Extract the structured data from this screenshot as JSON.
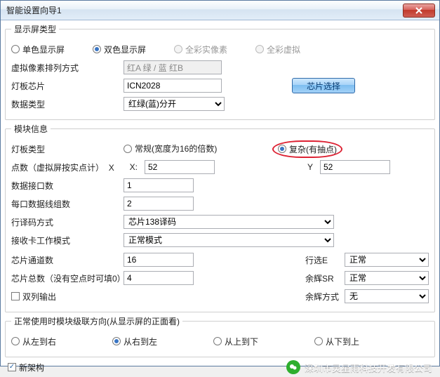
{
  "window": {
    "title": "智能设置向导1"
  },
  "group_display": {
    "legend": "显示屏类型",
    "opts": {
      "mono": "单色显示屏",
      "dual": "双色显示屏",
      "real": "全彩实像素",
      "virt": "全彩虚拟"
    },
    "virtual_arrange_label": "虚拟像素排列方式",
    "virtual_arrange_value": "红A 绿 / 蓝 红B",
    "chip_label": "灯板芯片",
    "chip_value": "ICN2028",
    "chip_btn": "芯片选择",
    "data_type_label": "数据类型",
    "data_type_value": "红绿(蓝)分开"
  },
  "group_module": {
    "legend": "模块信息",
    "board_type_label": "灯板类型",
    "board_type_normal": "常规(宽度为16的倍数)",
    "board_type_complex": "复杂(有抽点)",
    "points_label": "点数（虚拟屏按实点计）",
    "x_label": "X",
    "x_val": "52",
    "y_label": "Y",
    "y_val": "52",
    "port_label": "数据接口数",
    "port_val": "1",
    "lines_label": "每口数据线组数",
    "lines_val": "2",
    "decode_label": "行译码方式",
    "decode_val": "芯片138译码",
    "recv_mode_label": "接收卡工作模式",
    "recv_mode_val": "正常模式",
    "channels_label": "芯片通道数",
    "channels_val": "16",
    "total_label": "芯片总数（没有空点时可填0）",
    "total_val": "4",
    "dual_out": "双列输出",
    "row_e_label": "行选E",
    "row_e_val": "正常",
    "afterglow_sr_label": "余辉SR",
    "afterglow_sr_val": "正常",
    "afterglow_mode_label": "余辉方式",
    "afterglow_mode_val": "无"
  },
  "group_dir": {
    "legend": "正常使用时模块级联方向(从显示屏的正面看)",
    "lr": "从左到右",
    "rl": "从右到左",
    "tb": "从上到下",
    "bt": "从下到上"
  },
  "footer": {
    "new_arch": "新架构",
    "wechat_text": "深圳市灵星雨科技开发有限公司"
  }
}
